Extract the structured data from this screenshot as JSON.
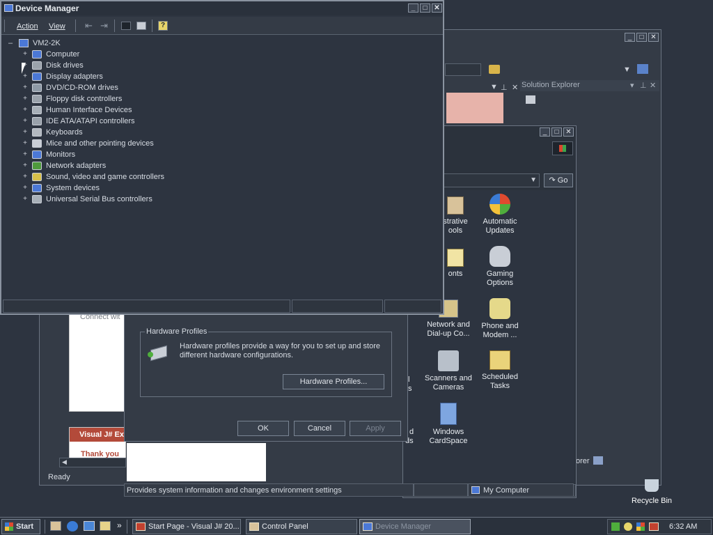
{
  "device_manager": {
    "title": "Device Manager",
    "menu": {
      "action": "Action",
      "view": "View"
    },
    "tree_root": "VM2-2K",
    "root_expander": "–",
    "expander": "+",
    "devices": [
      {
        "label": "Computer",
        "icon": "computer-icon",
        "color": "#4b78d6"
      },
      {
        "label": "Disk drives",
        "icon": "disk-drive-icon",
        "color": "#9aa2ab"
      },
      {
        "label": "Display adapters",
        "icon": "display-adapter-icon",
        "color": "#4b78d6"
      },
      {
        "label": "DVD/CD-ROM drives",
        "icon": "cdrom-icon",
        "color": "#8e9aa6"
      },
      {
        "label": "Floppy disk controllers",
        "icon": "floppy-controller-icon",
        "color": "#9aa2ab"
      },
      {
        "label": "Human Interface Devices",
        "icon": "hid-icon",
        "color": "#a8b0b8"
      },
      {
        "label": "IDE ATA/ATAPI controllers",
        "icon": "ide-controller-icon",
        "color": "#9aa2ab"
      },
      {
        "label": "Keyboards",
        "icon": "keyboard-icon",
        "color": "#b3b9c0"
      },
      {
        "label": "Mice and other pointing devices",
        "icon": "mouse-icon",
        "color": "#c9ced6"
      },
      {
        "label": "Monitors",
        "icon": "monitor-icon",
        "color": "#4b78d6"
      },
      {
        "label": "Network adapters",
        "icon": "network-adapter-icon",
        "color": "#4f9a3c"
      },
      {
        "label": "Sound, video and game controllers",
        "icon": "sound-icon",
        "color": "#d8c04a"
      },
      {
        "label": "System devices",
        "icon": "system-device-icon",
        "color": "#4b78d6"
      },
      {
        "label": "Universal Serial Bus controllers",
        "icon": "usb-icon",
        "color": "#a8b0b8"
      }
    ]
  },
  "system_properties": {
    "connect_text": "Connect wit",
    "hardware_profiles_group": "Hardware Profiles",
    "hardware_profiles_desc": "Hardware profiles provide a way for you to set up and store different hardware configurations.",
    "hardware_profiles_button": "Hardware Profiles...",
    "ok": "OK",
    "cancel": "Cancel",
    "apply": "Apply"
  },
  "visual_studio": {
    "solution_explorer": "Solution Explorer",
    "start_page_heading": "Visual J# Ex",
    "start_page_text": "Thank you",
    "status": "Ready",
    "explorer_tab": "orer"
  },
  "control_panel": {
    "go": "Go",
    "status_left": "Provides system information and changes environment settings",
    "status_right": "My Computer",
    "items": [
      {
        "label": "strative\nools",
        "icon": "administrative-tools-icon"
      },
      {
        "label": "Automatic\nUpdates",
        "icon": "automatic-updates-icon"
      },
      {
        "label": "onts",
        "icon": "fonts-icon"
      },
      {
        "label": "Gaming\nOptions",
        "icon": "gaming-options-icon"
      },
      {
        "label": "Network and\nDial-up Co...",
        "icon": "network-dialup-icon"
      },
      {
        "label": "Phone and\nModem ...",
        "icon": "phone-modem-icon"
      },
      {
        "label": "Scanners and\nCameras",
        "icon": "scanners-cameras-icon"
      },
      {
        "label": "Scheduled\nTasks",
        "icon": "scheduled-tasks-icon"
      },
      {
        "label": "Windows\nCardSpace",
        "icon": "cardspace-icon"
      }
    ],
    "partial_left_1": "l",
    "partial_left_2": "s",
    "partial_left_3": "d",
    "partial_left_4": "ds"
  },
  "desktop": {
    "recycle_bin": "Recycle Bin"
  },
  "taskbar": {
    "start": "Start",
    "quicklaunch_more": "»",
    "tasks": [
      {
        "label": "Start Page - Visual J# 20..."
      },
      {
        "label": "Control Panel"
      },
      {
        "label": "Device Manager"
      }
    ],
    "clock": "6:32 AM"
  }
}
